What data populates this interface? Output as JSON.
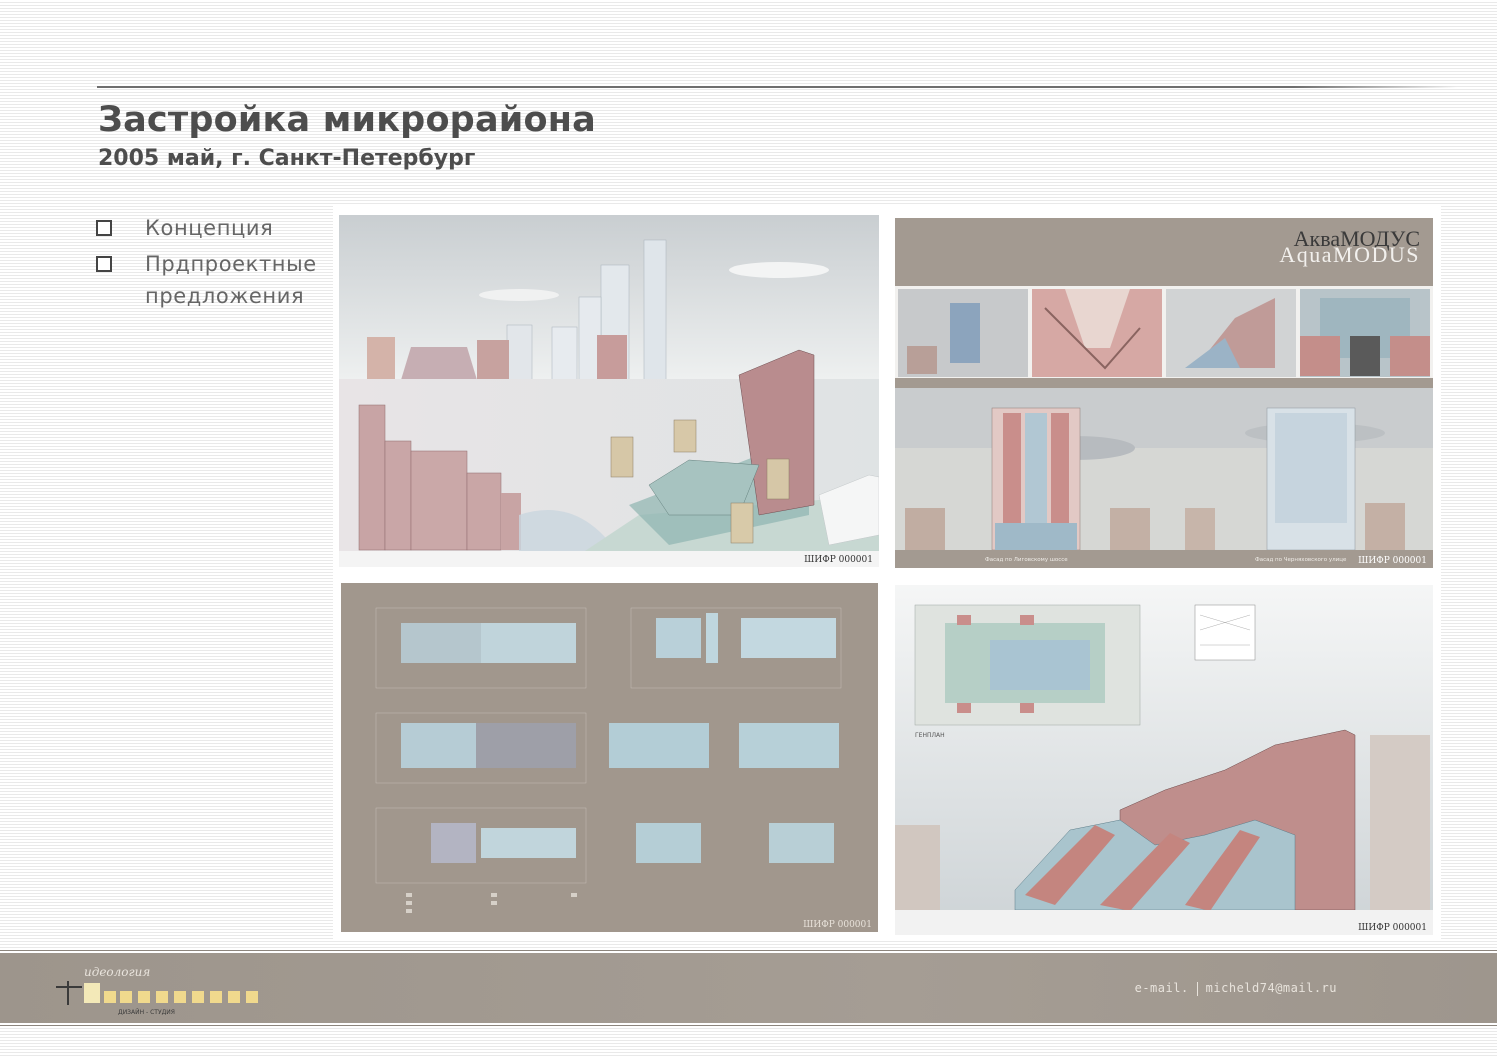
{
  "header": {
    "title": "Застройка микрорайона",
    "subtitle": "2005 май, г. Санкт-Петербург"
  },
  "menu": {
    "items": [
      {
        "label": "Концепция"
      },
      {
        "label": "Прдпроектные предложения"
      }
    ]
  },
  "panels": {
    "p1": {
      "cipher": "ШИФР 000001"
    },
    "p2": {
      "brand_ru": "АкваМОДУС",
      "brand_en": "AquaMODUS",
      "caption_left": "Фасад по Лиговскому шоссе",
      "caption_right": "Фасад по Черняховского улице",
      "cipher": "ШИФР 000001"
    },
    "p3": {
      "cipher": "ШИФР 000001"
    },
    "p4": {
      "cipher": "ШИФР 000001",
      "plan_label": "ГЕНПЛАН"
    }
  },
  "footer": {
    "logo_top": "идеология",
    "logo_bottom": "ДИЗАЙН - СТУДИЯ",
    "email_label": "e-mail.",
    "email": "micheld74@mail.ru"
  },
  "colors": {
    "title": "#4d4d4d",
    "panel_taupe": "#a39a91",
    "footer": "#a0988f"
  }
}
